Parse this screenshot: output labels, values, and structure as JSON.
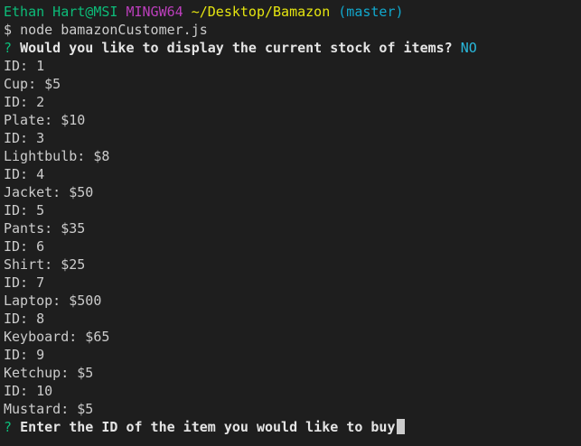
{
  "prompt": {
    "user_host": "Ethan Hart@MSI",
    "system": "MINGW64",
    "path": "~/Desktop/Bamazon",
    "branch": "(master)",
    "dollar": "$",
    "command": "node bamazonCustomer.js"
  },
  "question1": {
    "marker": "?",
    "text": "Would you like to display the current stock of items?",
    "answer": "NO"
  },
  "output": [
    "ID: 1",
    "Cup: $5",
    "ID: 2",
    "Plate: $10",
    "ID: 3",
    "Lightbulb: $8",
    "ID: 4",
    "Jacket: $50",
    "ID: 5",
    "Pants: $35",
    "ID: 6",
    "Shirt: $25",
    "ID: 7",
    "Laptop: $500",
    "ID: 8",
    "Keyboard: $65",
    "ID: 9",
    "Ketchup: $5",
    "ID: 10",
    "Mustard: $5"
  ],
  "question2": {
    "marker": "?",
    "text": "Enter the ID of the item you would like to buy"
  },
  "colors": {
    "background": "#1e1e1e",
    "text": "#cccccc",
    "green": "#0dbc79",
    "magenta": "#bc3fbc",
    "yellow": "#e5e510",
    "cyan": "#11a8cd"
  }
}
